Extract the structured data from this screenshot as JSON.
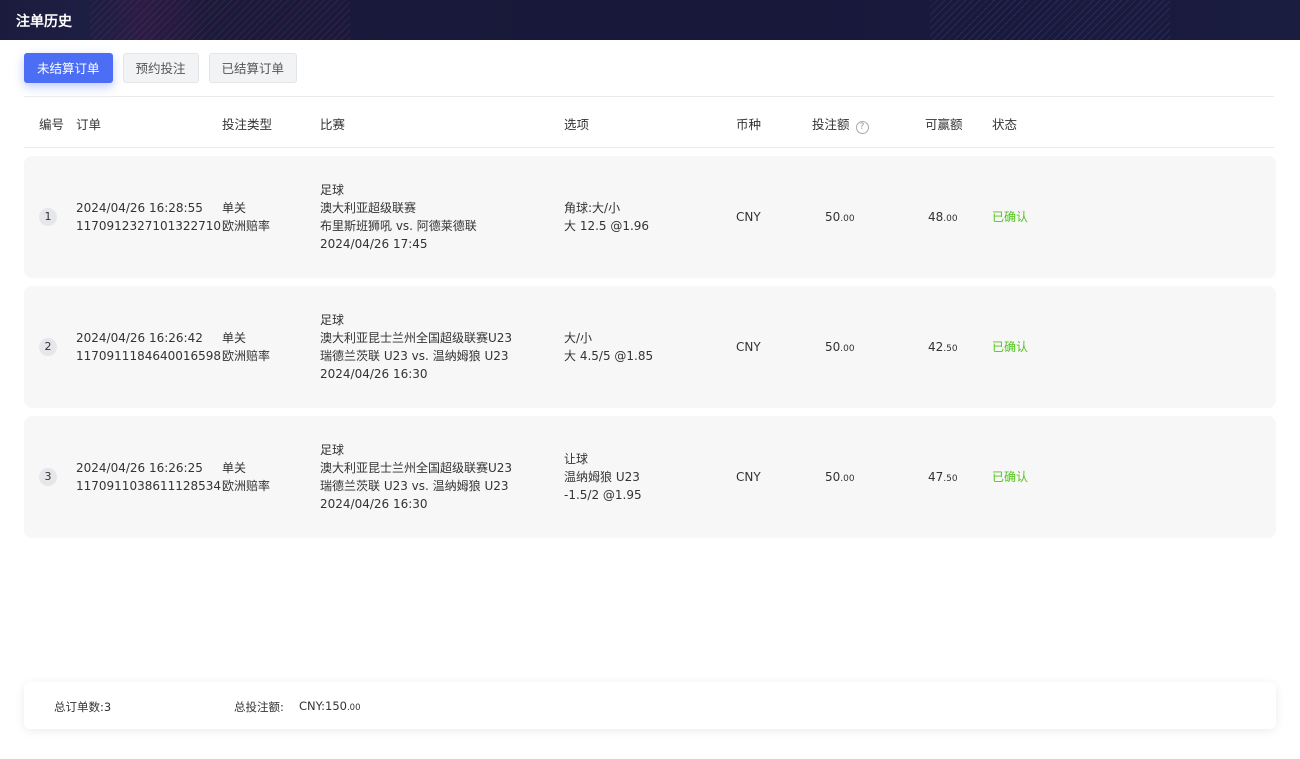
{
  "page": {
    "title": "注单历史"
  },
  "tabs": [
    {
      "label": "未结算订单",
      "active": true
    },
    {
      "label": "预约投注",
      "active": false
    },
    {
      "label": "已结算订单",
      "active": false
    }
  ],
  "table": {
    "headers": {
      "no": "编号",
      "order": "订单",
      "bet_type": "投注类型",
      "match": "比赛",
      "option": "选项",
      "currency": "币种",
      "stake": "投注额",
      "win": "可赢额",
      "status": "状态"
    },
    "rows": [
      {
        "no": "1",
        "time": "2024/04/26 16:28:55",
        "order_id": "1170912327101322710",
        "type1": "单关",
        "type2": "欧洲赔率",
        "sport": "足球",
        "league": "澳大利亚超级联赛",
        "teams": "布里斯班狮吼 vs. 阿德莱德联",
        "match_time": "2024/04/26 17:45",
        "option_lines": [
          "角球:大/小",
          "大 12.5 @1.96"
        ],
        "currency": "CNY",
        "stake_int": "50",
        "stake_dec": ".00",
        "win_int": "48",
        "win_dec": ".00",
        "status": "已确认"
      },
      {
        "no": "2",
        "time": "2024/04/26 16:26:42",
        "order_id": "1170911184640016598",
        "type1": "单关",
        "type2": "欧洲赔率",
        "sport": "足球",
        "league": "澳大利亚昆士兰州全国超级联赛U23",
        "teams": "瑞德兰茨联 U23 vs. 温纳姆狼 U23",
        "match_time": "2024/04/26 16:30",
        "option_lines": [
          "大/小",
          "大 4.5/5 @1.85"
        ],
        "currency": "CNY",
        "stake_int": "50",
        "stake_dec": ".00",
        "win_int": "42",
        "win_dec": ".50",
        "status": "已确认"
      },
      {
        "no": "3",
        "time": "2024/04/26 16:26:25",
        "order_id": "1170911038611128534",
        "type1": "单关",
        "type2": "欧洲赔率",
        "sport": "足球",
        "league": "澳大利亚昆士兰州全国超级联赛U23",
        "teams": "瑞德兰茨联 U23 vs. 温纳姆狼 U23",
        "match_time": "2024/04/26 16:30",
        "option_lines": [
          "让球",
          "温纳姆狼 U23",
          "-1.5/2 @1.95"
        ],
        "currency": "CNY",
        "stake_int": "50",
        "stake_dec": ".00",
        "win_int": "47",
        "win_dec": ".50",
        "status": "已确认"
      }
    ]
  },
  "footer": {
    "total_orders": "总订单数:3",
    "total_stake_label": "总投注额:",
    "total_stake_int": "CNY:150",
    "total_stake_dec": ".00"
  },
  "colors": {
    "accent": "#4c6ef5",
    "confirmed": "#52c41a",
    "header_bg": "#17183a"
  }
}
